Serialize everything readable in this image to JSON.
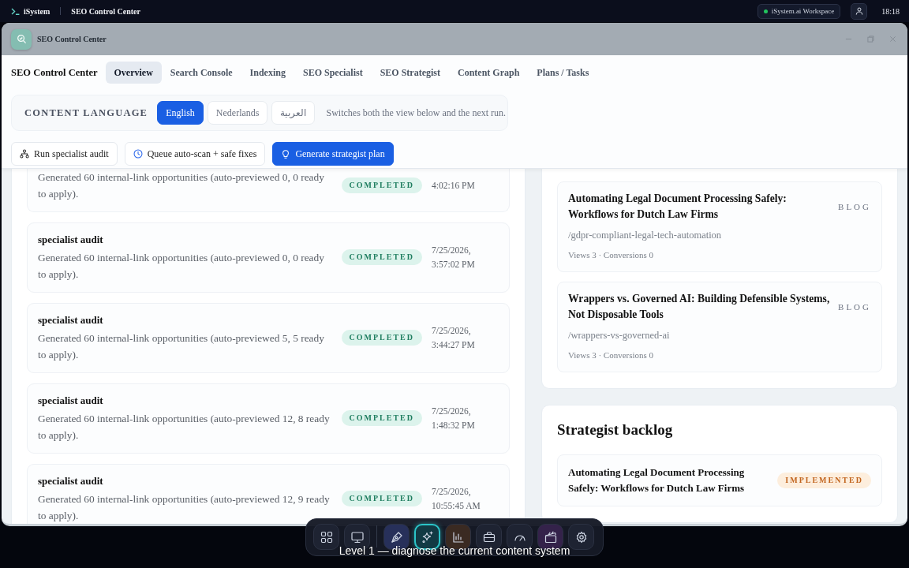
{
  "top_bar": {
    "app_name": "iSystem",
    "context": "SEO Control Center",
    "workspace": "iSystem.ai Workspace",
    "time": "18:18"
  },
  "window": {
    "title": "SEO Control Center"
  },
  "nav": {
    "heading": "SEO Control Center",
    "tabs": [
      {
        "label": "Overview",
        "selected": true
      },
      {
        "label": "Search Console",
        "selected": false
      },
      {
        "label": "Indexing",
        "selected": false
      },
      {
        "label": "SEO Specialist",
        "selected": false
      },
      {
        "label": "SEO Strategist",
        "selected": false
      },
      {
        "label": "Content Graph",
        "selected": false
      },
      {
        "label": "Plans / Tasks",
        "selected": false
      }
    ]
  },
  "language": {
    "label": "CONTENT LANGUAGE",
    "options": [
      {
        "label": "English",
        "selected": true
      },
      {
        "label": "Nederlands",
        "selected": false
      },
      {
        "label": "العربية",
        "selected": false
      }
    ],
    "hint": "Switches both the view below and the next run."
  },
  "actions": [
    {
      "label": "Run specialist audit",
      "kind": "audit",
      "primary": false
    },
    {
      "label": "Queue auto-scan + safe fixes",
      "kind": "schedule",
      "primary": false
    },
    {
      "label": "Generate strategist plan",
      "kind": "idea",
      "primary": true
    }
  ],
  "runs": [
    {
      "description": "Generated 60 internal-link opportunities (auto-previewed 0, 0 ready to apply).",
      "status": {
        "label": "COMPLETED",
        "kind": "completed"
      },
      "time": "4:02:16 PM"
    },
    {
      "title": "specialist audit",
      "description": "Generated 60 internal-link opportunities (auto-previewed 0, 0 ready to apply).",
      "status": {
        "label": "COMPLETED",
        "kind": "completed"
      },
      "date": "7/25/2026,",
      "time": "3:57:02 PM"
    },
    {
      "title": "specialist audit",
      "description": "Generated 60 internal-link opportunities (auto-previewed 5, 5 ready to apply).",
      "status": {
        "label": "COMPLETED",
        "kind": "completed"
      },
      "date": "7/25/2026,",
      "time": "3:44:27 PM"
    },
    {
      "title": "specialist audit",
      "description": "Generated 60 internal-link opportunities (auto-previewed 12, 8 ready to apply).",
      "status": {
        "label": "COMPLETED",
        "kind": "completed"
      },
      "date": "7/25/2026,",
      "time": "1:48:32 PM"
    },
    {
      "title": "specialist audit",
      "description": "Generated 60 internal-link opportunities (auto-previewed 12, 9 ready to apply).",
      "status": {
        "label": "COMPLETED",
        "kind": "completed"
      },
      "date": "7/25/2026,",
      "time": "10:55:45 AM"
    }
  ],
  "pages": [
    {
      "title": "Automating Legal Document Processing Safely: Workflows for Dutch Law Firms",
      "type": "BLOG",
      "slug": "/gdpr-compliant-legal-tech-automation",
      "stats": "Views 3 · Conversions 0"
    },
    {
      "title": "Wrappers vs. Governed AI: Building Defensible Systems, Not Disposable Tools",
      "type": "BLOG",
      "slug": "/wrappers-vs-governed-ai",
      "stats": "Views 3 · Conversions 0"
    }
  ],
  "backlog": {
    "heading": "Strategist backlog",
    "items": [
      {
        "title": "Automating Legal Document Processing Safely: Workflows for Dutch Law Firms",
        "status": {
          "label": "IMPLEMENTED",
          "kind": "implemented"
        }
      }
    ]
  },
  "dock": {
    "pinned": [
      {
        "kind": "apps",
        "selected": false
      },
      {
        "kind": "desktop",
        "selected": false
      }
    ],
    "apps": [
      {
        "kind": "design",
        "selected": false
      },
      {
        "kind": "ai",
        "selected": true
      },
      {
        "kind": "analytics",
        "selected": false
      },
      {
        "kind": "business",
        "selected": false
      },
      {
        "kind": "performance",
        "selected": false
      },
      {
        "kind": "media",
        "selected": false
      },
      {
        "kind": "settings",
        "selected": false
      }
    ]
  },
  "caption": "Level 1 — diagnose the current content system"
}
